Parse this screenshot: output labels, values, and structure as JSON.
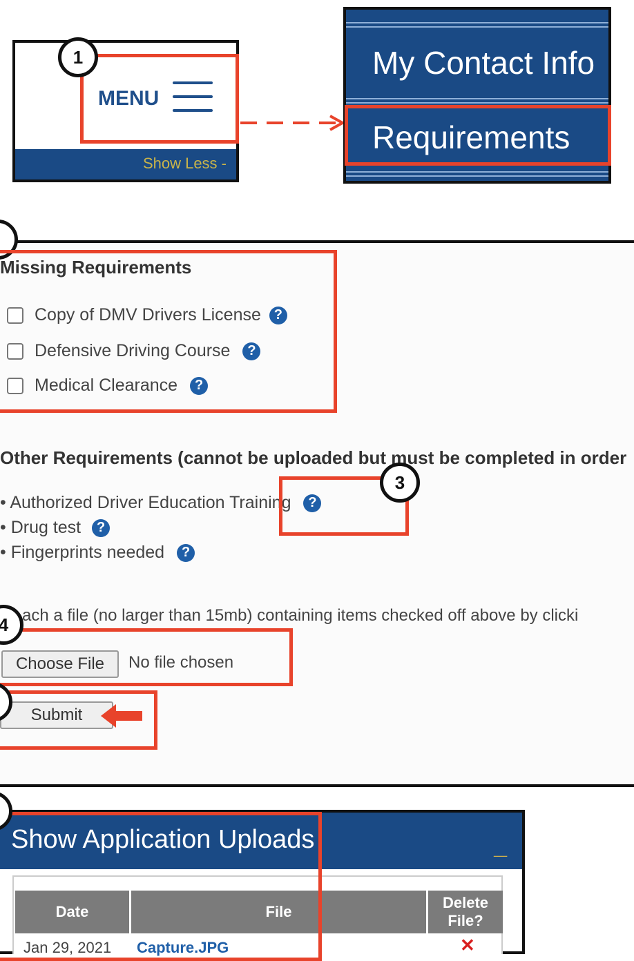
{
  "menu_panel": {
    "label": "MENU",
    "show_less": "Show Less -"
  },
  "nav_panel": {
    "items": [
      "My Contact Info",
      "Requirements"
    ]
  },
  "badges": [
    "1",
    "3",
    "4"
  ],
  "missing": {
    "title": "Missing Requirements",
    "items": [
      "Copy of DMV Drivers License",
      "Defensive Driving Course",
      "Medical Clearance"
    ]
  },
  "other": {
    "title": "Other Requirements (cannot be uploaded but must be completed in order",
    "items": [
      "• Authorized Driver Education Training",
      "• Drug test",
      "• Fingerprints needed"
    ]
  },
  "attach": {
    "instruction": "ach a file (no larger than 15mb) containing items checked off above by clicki",
    "choose_label": "Choose File",
    "file_status": "No file chosen",
    "submit_label": "Submit"
  },
  "uploads": {
    "title": "Show Application Uploads",
    "toggle": "_",
    "columns": [
      "Date",
      "File",
      "Delete File?"
    ],
    "rows": [
      {
        "date": "Jan 29, 2021",
        "file": "Capture.JPG",
        "delete": "✕"
      }
    ]
  },
  "help_glyph": "?",
  "colors": {
    "accent_blue": "#1a4a85",
    "highlight_red": "#e8432b",
    "gold": "#c9b44a"
  }
}
